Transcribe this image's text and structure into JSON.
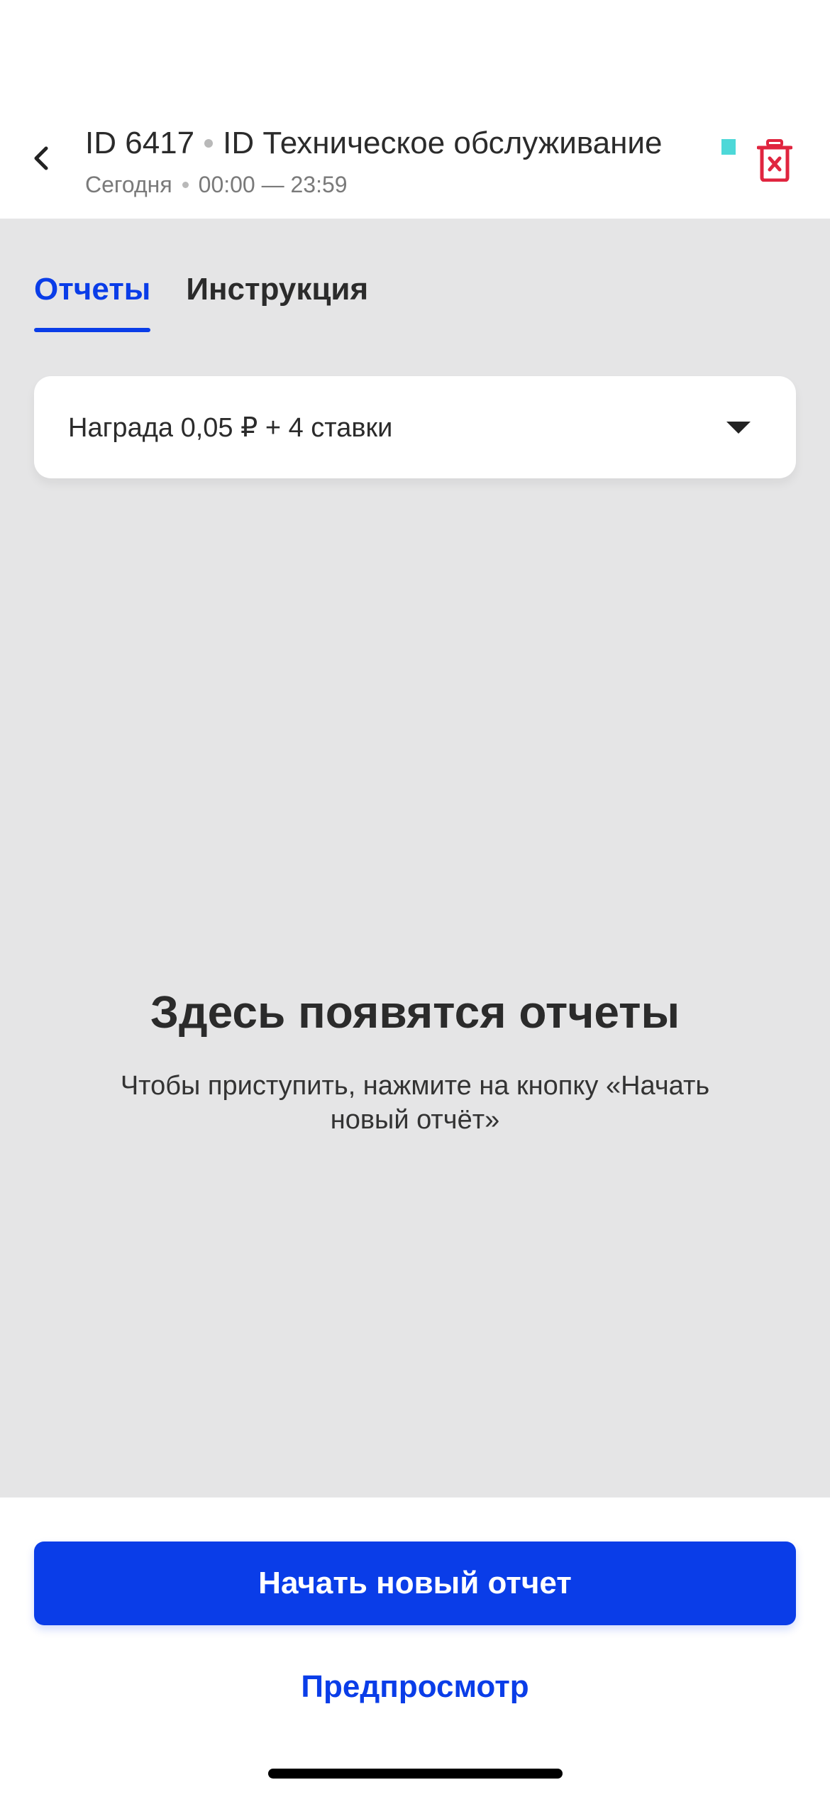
{
  "header": {
    "id_label": "ID 6417",
    "title": "ID Техническое обслуживание",
    "date_label": "Сегодня",
    "time_range": "00:00 — 23:59",
    "status_color": "#4dd8d8",
    "back_icon": "chevron-left-icon",
    "delete_icon": "trash-icon"
  },
  "tabs": [
    {
      "label": "Отчеты",
      "active": true
    },
    {
      "label": "Инструкция",
      "active": false
    }
  ],
  "reward_select": {
    "value": "Награда 0,05 ₽ + 4 ставки",
    "icon": "caret-down-icon"
  },
  "empty_state": {
    "title": "Здесь появятся отчеты",
    "description": "Чтобы приступить, нажмите на кнопку «Начать новый отчёт»"
  },
  "actions": {
    "primary_label": "Начать новый отчет",
    "secondary_label": "Предпросмотр"
  },
  "colors": {
    "accent": "#0a3de8",
    "delete": "#e0253f",
    "background": "#e5e5e6"
  }
}
